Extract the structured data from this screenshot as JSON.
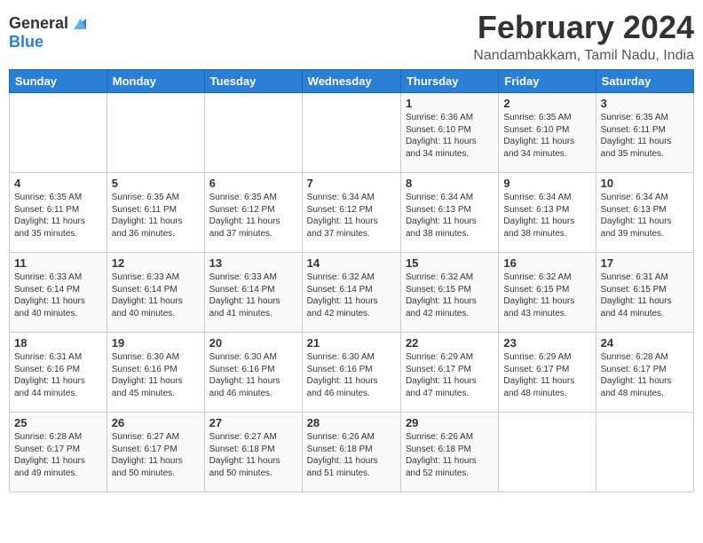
{
  "logo": {
    "general": "General",
    "blue": "Blue"
  },
  "title": "February 2024",
  "subtitle": "Nandambakkam, Tamil Nadu, India",
  "days_of_week": [
    "Sunday",
    "Monday",
    "Tuesday",
    "Wednesday",
    "Thursday",
    "Friday",
    "Saturday"
  ],
  "weeks": [
    [
      {
        "day": "",
        "info": ""
      },
      {
        "day": "",
        "info": ""
      },
      {
        "day": "",
        "info": ""
      },
      {
        "day": "",
        "info": ""
      },
      {
        "day": "1",
        "info": "Sunrise: 6:36 AM\nSunset: 6:10 PM\nDaylight: 11 hours\nand 34 minutes."
      },
      {
        "day": "2",
        "info": "Sunrise: 6:35 AM\nSunset: 6:10 PM\nDaylight: 11 hours\nand 34 minutes."
      },
      {
        "day": "3",
        "info": "Sunrise: 6:35 AM\nSunset: 6:11 PM\nDaylight: 11 hours\nand 35 minutes."
      }
    ],
    [
      {
        "day": "4",
        "info": "Sunrise: 6:35 AM\nSunset: 6:11 PM\nDaylight: 11 hours\nand 35 minutes."
      },
      {
        "day": "5",
        "info": "Sunrise: 6:35 AM\nSunset: 6:11 PM\nDaylight: 11 hours\nand 36 minutes."
      },
      {
        "day": "6",
        "info": "Sunrise: 6:35 AM\nSunset: 6:12 PM\nDaylight: 11 hours\nand 37 minutes."
      },
      {
        "day": "7",
        "info": "Sunrise: 6:34 AM\nSunset: 6:12 PM\nDaylight: 11 hours\nand 37 minutes."
      },
      {
        "day": "8",
        "info": "Sunrise: 6:34 AM\nSunset: 6:13 PM\nDaylight: 11 hours\nand 38 minutes."
      },
      {
        "day": "9",
        "info": "Sunrise: 6:34 AM\nSunset: 6:13 PM\nDaylight: 11 hours\nand 38 minutes."
      },
      {
        "day": "10",
        "info": "Sunrise: 6:34 AM\nSunset: 6:13 PM\nDaylight: 11 hours\nand 39 minutes."
      }
    ],
    [
      {
        "day": "11",
        "info": "Sunrise: 6:33 AM\nSunset: 6:14 PM\nDaylight: 11 hours\nand 40 minutes."
      },
      {
        "day": "12",
        "info": "Sunrise: 6:33 AM\nSunset: 6:14 PM\nDaylight: 11 hours\nand 40 minutes."
      },
      {
        "day": "13",
        "info": "Sunrise: 6:33 AM\nSunset: 6:14 PM\nDaylight: 11 hours\nand 41 minutes."
      },
      {
        "day": "14",
        "info": "Sunrise: 6:32 AM\nSunset: 6:14 PM\nDaylight: 11 hours\nand 42 minutes."
      },
      {
        "day": "15",
        "info": "Sunrise: 6:32 AM\nSunset: 6:15 PM\nDaylight: 11 hours\nand 42 minutes."
      },
      {
        "day": "16",
        "info": "Sunrise: 6:32 AM\nSunset: 6:15 PM\nDaylight: 11 hours\nand 43 minutes."
      },
      {
        "day": "17",
        "info": "Sunrise: 6:31 AM\nSunset: 6:15 PM\nDaylight: 11 hours\nand 44 minutes."
      }
    ],
    [
      {
        "day": "18",
        "info": "Sunrise: 6:31 AM\nSunset: 6:16 PM\nDaylight: 11 hours\nand 44 minutes."
      },
      {
        "day": "19",
        "info": "Sunrise: 6:30 AM\nSunset: 6:16 PM\nDaylight: 11 hours\nand 45 minutes."
      },
      {
        "day": "20",
        "info": "Sunrise: 6:30 AM\nSunset: 6:16 PM\nDaylight: 11 hours\nand 46 minutes."
      },
      {
        "day": "21",
        "info": "Sunrise: 6:30 AM\nSunset: 6:16 PM\nDaylight: 11 hours\nand 46 minutes."
      },
      {
        "day": "22",
        "info": "Sunrise: 6:29 AM\nSunset: 6:17 PM\nDaylight: 11 hours\nand 47 minutes."
      },
      {
        "day": "23",
        "info": "Sunrise: 6:29 AM\nSunset: 6:17 PM\nDaylight: 11 hours\nand 48 minutes."
      },
      {
        "day": "24",
        "info": "Sunrise: 6:28 AM\nSunset: 6:17 PM\nDaylight: 11 hours\nand 48 minutes."
      }
    ],
    [
      {
        "day": "25",
        "info": "Sunrise: 6:28 AM\nSunset: 6:17 PM\nDaylight: 11 hours\nand 49 minutes."
      },
      {
        "day": "26",
        "info": "Sunrise: 6:27 AM\nSunset: 6:17 PM\nDaylight: 11 hours\nand 50 minutes."
      },
      {
        "day": "27",
        "info": "Sunrise: 6:27 AM\nSunset: 6:18 PM\nDaylight: 11 hours\nand 50 minutes."
      },
      {
        "day": "28",
        "info": "Sunrise: 6:26 AM\nSunset: 6:18 PM\nDaylight: 11 hours\nand 51 minutes."
      },
      {
        "day": "29",
        "info": "Sunrise: 6:26 AM\nSunset: 6:18 PM\nDaylight: 11 hours\nand 52 minutes."
      },
      {
        "day": "",
        "info": ""
      },
      {
        "day": "",
        "info": ""
      }
    ]
  ]
}
